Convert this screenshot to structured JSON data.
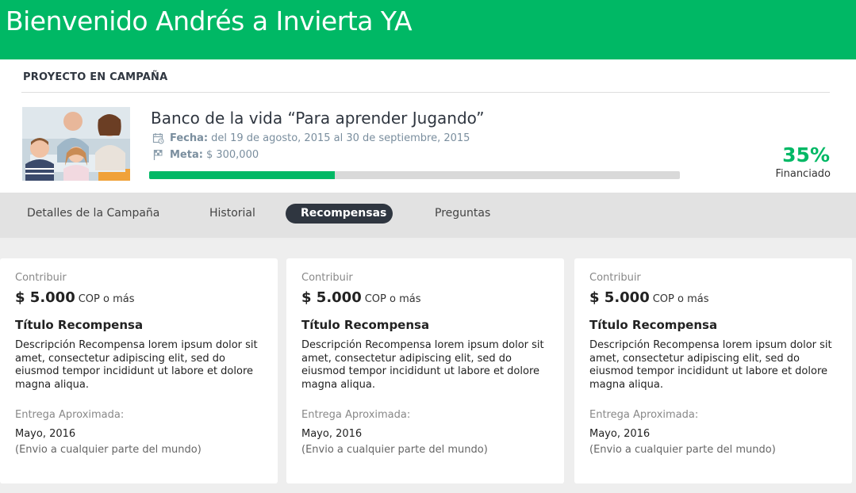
{
  "header": {
    "title": "Bienvenido Andrés a Invierta YA"
  },
  "colors": {
    "brand": "#00b865",
    "active_tab": "#2f3640",
    "muted": "#7a8e9e"
  },
  "project": {
    "section_label": "PROYECTO EN CAMPAÑA",
    "image_name": "family-photo",
    "title": "Banco de la vida “Para aprender Jugando”",
    "fecha_label": "Fecha:",
    "fecha_value": "del 19 de agosto, 2015 al 30 de septiembre, 2015",
    "meta_label": "Meta:",
    "meta_value": "$ 300,000",
    "progress_percent": 35,
    "percent_text": "35%",
    "financed_label": "Financiado"
  },
  "tabs": [
    {
      "label": "Detalles de la Campaña",
      "active": false
    },
    {
      "label": "Historial",
      "active": false
    },
    {
      "label": "Recompensas",
      "active": true
    },
    {
      "label": "Preguntas",
      "active": false
    }
  ],
  "rewards": [
    {
      "contrib_label": "Contribuir",
      "amount": "$ 5.000",
      "currency": "COP o más",
      "title": "Título Recompensa",
      "description": "Descripción Recompensa lorem ipsum dolor sit amet, consectetur adipiscing elit, sed do eiusmod tempor incididunt ut labore et dolore magna aliqua.",
      "delivery_label": "Entrega Aproximada:",
      "delivery_date": "Mayo, 2016",
      "delivery_note": "(Envio a cualquier parte del mundo)"
    },
    {
      "contrib_label": "Contribuir",
      "amount": "$ 5.000",
      "currency": "COP o más",
      "title": "Título Recompensa",
      "description": "Descripción Recompensa lorem ipsum dolor sit amet, consectetur adipiscing elit, sed do eiusmod tempor incididunt ut labore et dolore magna aliqua.",
      "delivery_label": "Entrega Aproximada:",
      "delivery_date": "Mayo, 2016",
      "delivery_note": "(Envio a cualquier parte del mundo)"
    },
    {
      "contrib_label": "Contribuir",
      "amount": "$ 5.000",
      "currency": "COP o más",
      "title": "Título Recompensa",
      "description": "Descripción Recompensa lorem ipsum dolor sit amet, consectetur adipiscing elit, sed do eiusmod tempor incididunt ut labore et dolore magna aliqua.",
      "delivery_label": "Entrega Aproximada:",
      "delivery_date": "Mayo, 2016",
      "delivery_note": "(Envio a cualquier parte del mundo)"
    }
  ]
}
